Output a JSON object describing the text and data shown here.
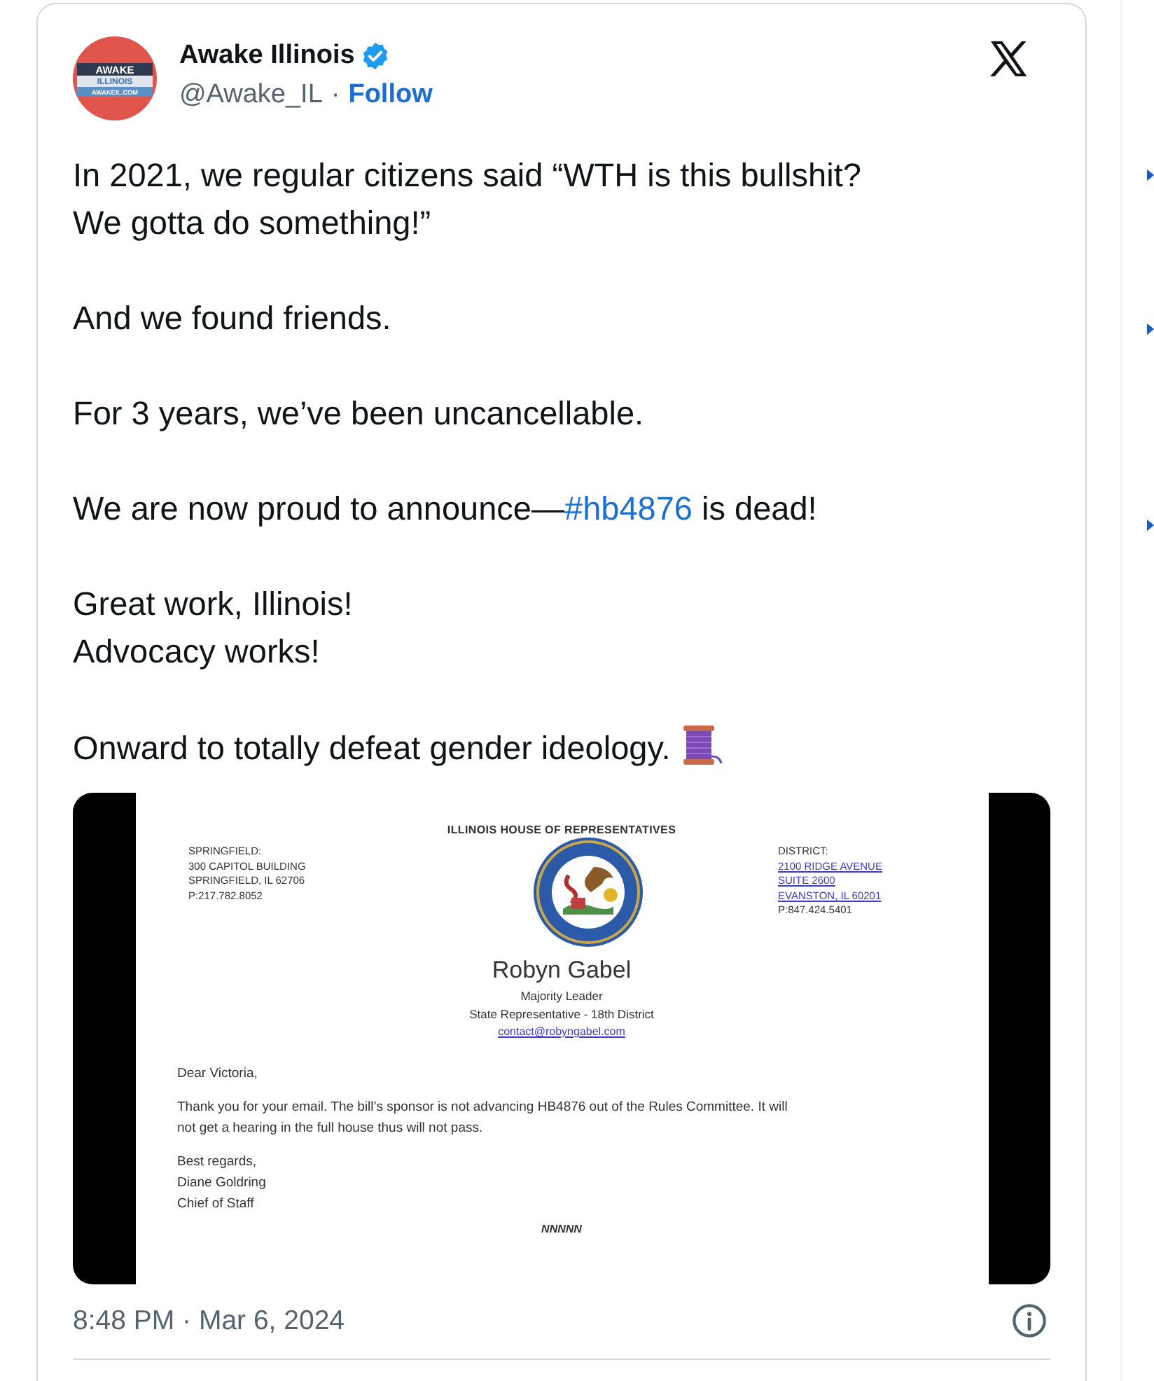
{
  "tweet": {
    "avatar": {
      "lines": [
        "AWAKE",
        "ILLINOIS",
        "AWAKEIL.COM"
      ]
    },
    "author": {
      "name": "Awake Illinois",
      "verified": true,
      "handle": "@Awake_IL",
      "separator": "·",
      "follow": "Follow"
    },
    "paragraphs": [
      [
        [
          {
            "kind": "text",
            "text": "In 2021, we regular citizens said “WTH is this bullshit?"
          }
        ],
        [
          {
            "kind": "text",
            "text": "We gotta do something!”"
          }
        ]
      ],
      [
        [
          {
            "kind": "text",
            "text": "And we found friends."
          }
        ]
      ],
      [
        [
          {
            "kind": "text",
            "text": "For 3 years, we’ve been uncancellable."
          }
        ]
      ],
      [
        [
          {
            "kind": "text",
            "text": "We are now proud to announce—"
          },
          {
            "kind": "hashtag",
            "text": "#hb4876"
          },
          {
            "kind": "text",
            "text": " is dead!"
          }
        ]
      ],
      [
        [
          {
            "kind": "text",
            "text": "Great work, Illinois!"
          }
        ],
        [
          {
            "kind": "text",
            "text": "Advocacy works!"
          }
        ]
      ],
      [
        [
          {
            "kind": "text",
            "text": "Onward to totally defeat gender ideology."
          },
          {
            "kind": "spool"
          }
        ]
      ]
    ],
    "letter": {
      "heading": "ILLINOIS HOUSE OF REPRESENTATIVES",
      "left_address": [
        "SPRINGFIELD:",
        "300 CAPITOL BUILDING",
        "SPRINGFIELD, IL 62706",
        "P:217.782.8052"
      ],
      "right_address": [
        {
          "text": "DISTRICT:",
          "link": false
        },
        {
          "text": "2100 RIDGE AVENUE",
          "link": true
        },
        {
          "text": "SUITE 2600",
          "link": true
        },
        {
          "text": "EVANSTON, IL 60201",
          "link": true
        },
        {
          "text": "P:847.424.5401",
          "link": false
        }
      ],
      "name": "Robyn Gabel",
      "titles": [
        "Majority Leader",
        "State Representative - 18th District"
      ],
      "email": "contact@robyngabel.com",
      "greeting": "Dear Victoria,",
      "body": "Thank you for your email.  The bill’s sponsor is not advancing HB4876 out of the Rules Committee. It will not get a hearing in the full house thus will not pass.",
      "closing": [
        "Best regards,",
        "Diane Goldring",
        "Chief of Staff"
      ],
      "footer": "NNNNN"
    },
    "timestamp": "8:48 PM · Mar 6, 2024"
  }
}
